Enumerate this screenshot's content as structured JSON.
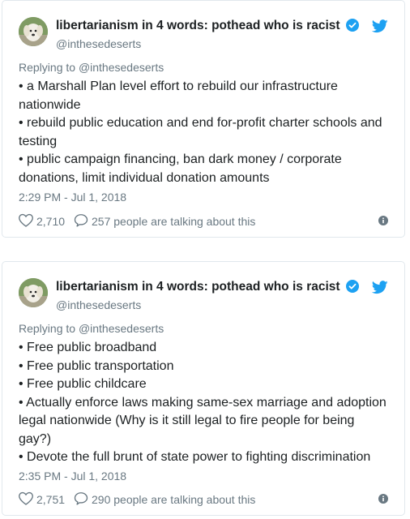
{
  "tweets": [
    {
      "display_name": "libertarianism in 4 words: pothead who is racist",
      "handle": "@inthesedeserts",
      "replying_prefix": "Replying to ",
      "replying_to": "@inthesedeserts",
      "lines": [
        "• a Marshall Plan level effort to rebuild our infrastructure",
        "nationwide",
        "• rebuild public education and end for-profit charter schools and",
        "testing",
        "• public campaign financing, ban dark money / corporate",
        "donations, limit individual donation amounts"
      ],
      "timestamp": "2:29 PM - Jul 1, 2018",
      "likes": "2,710",
      "talking": "257 people are talking about this"
    },
    {
      "display_name": "libertarianism in 4 words: pothead who is racist",
      "handle": "@inthesedeserts",
      "replying_prefix": "Replying to ",
      "replying_to": "@inthesedeserts",
      "lines": [
        "• Free public broadband",
        "• Free public transportation",
        "• Free public childcare",
        "• Actually enforce laws making same-sex marriage and adoption",
        "legal nationwide (Why is it still legal to fire people for being",
        "gay?)",
        "• Devote the full brunt of state power to fighting discrimination"
      ],
      "timestamp": "2:35 PM - Jul 1, 2018",
      "likes": "2,751",
      "talking": "290 people are talking about this"
    }
  ],
  "colors": {
    "brand": "#1da1f2",
    "verified": "#1da1f2",
    "muted": "#697882",
    "border": "#e1e8ed",
    "text": "#1c2022"
  },
  "icons": [
    "avatar-dog",
    "verified-badge-icon",
    "twitter-bird-icon",
    "heart-icon",
    "speech-bubble-icon",
    "info-icon"
  ]
}
